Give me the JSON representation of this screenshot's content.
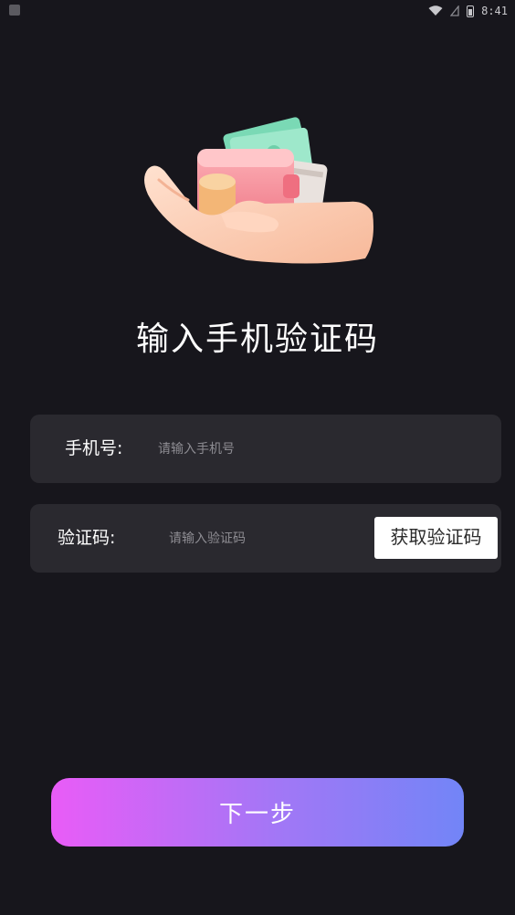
{
  "status_bar": {
    "time": "8:41"
  },
  "page": {
    "title": "输入手机验证码"
  },
  "phone_field": {
    "label": "手机号:",
    "placeholder": "请输入手机号",
    "value": ""
  },
  "code_field": {
    "label": "验证码:",
    "placeholder": "请输入验证码",
    "value": "",
    "get_code_label": "获取验证码"
  },
  "actions": {
    "next_label": "下一步"
  },
  "colors": {
    "background": "#17161c",
    "field_background": "#2a292f",
    "gradient_start": "#e95cf7",
    "gradient_end": "#7285f7"
  },
  "icons": {
    "hero": "hand-holding-wallet-illustration"
  }
}
